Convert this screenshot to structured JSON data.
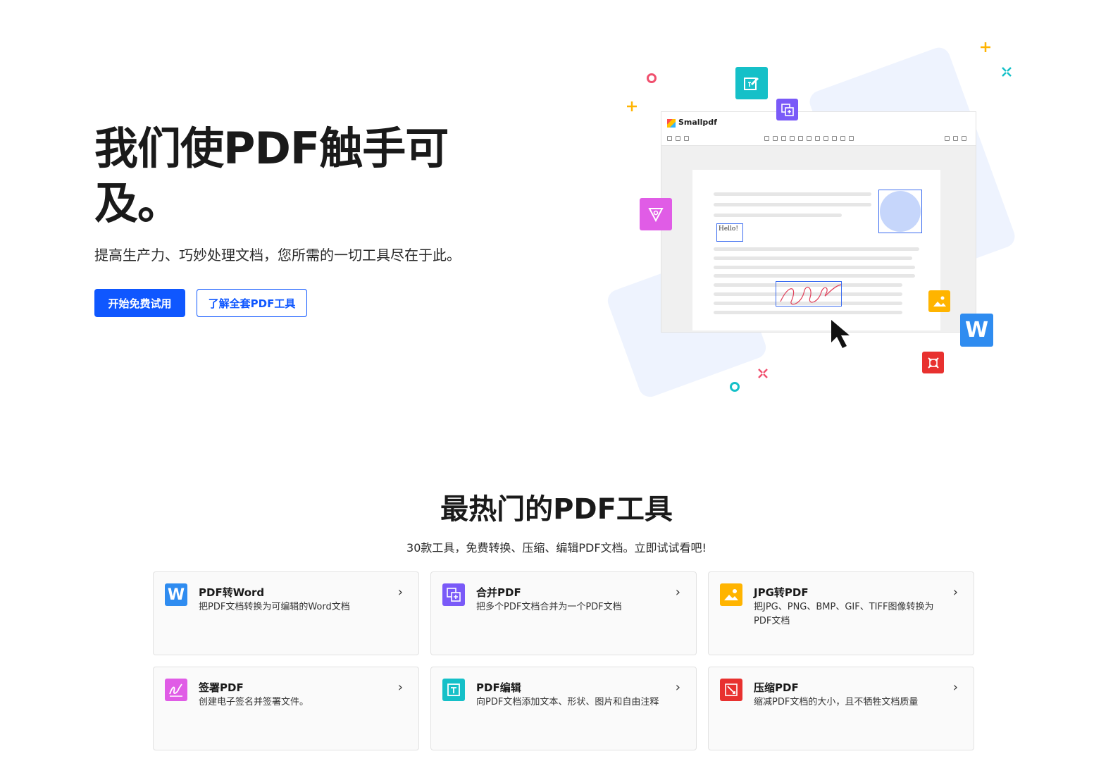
{
  "hero": {
    "title": "我们使PDF触手可及。",
    "subtitle": "提高生产力、巧妙处理文档，您所需的一切工具尽在于此。",
    "primary_button": "开始免费试用",
    "secondary_button": "了解全套PDF工具"
  },
  "illustration": {
    "app_name": "Smallpdf",
    "hello_text": "Hello!",
    "word_icon_letter": "W"
  },
  "section": {
    "title": "最热门的PDF工具",
    "subtitle": "30款工具，免费转换、压缩、编辑PDF文档。立即试试看吧!"
  },
  "tools": [
    {
      "title": "PDF转Word",
      "desc": "把PDF文档转换为可编辑的Word文档",
      "icon": "word-icon",
      "color": "#2f8cf0"
    },
    {
      "title": "合并PDF",
      "desc": "把多个PDF文档合并为一个PDF文档",
      "icon": "merge-icon",
      "color": "#7a5af8"
    },
    {
      "title": "JPG转PDF",
      "desc": "把JPG、PNG、BMP、GIF、TIFF图像转换为PDF文档",
      "icon": "image-icon",
      "color": "#ffb400"
    },
    {
      "title": "签署PDF",
      "desc": "创建电子签名并签署文件。",
      "icon": "signature-icon",
      "color": "#e05ce6"
    },
    {
      "title": "PDF编辑",
      "desc": "向PDF文档添加文本、形状、图片和自由注释",
      "icon": "edit-text-icon",
      "color": "#15c0c8"
    },
    {
      "title": "压缩PDF",
      "desc": "缩减PDF文档的大小，且不牺牲文档质量",
      "icon": "compress-icon",
      "color": "#e8312f"
    }
  ],
  "arrow_glyph": "›",
  "colors": {
    "brand": "#0f57ff"
  }
}
